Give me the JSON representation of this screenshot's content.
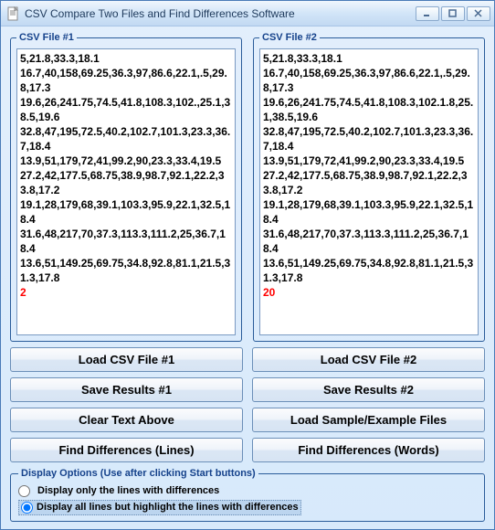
{
  "window": {
    "title": "CSV Compare Two Files and Find Differences Software"
  },
  "files": {
    "left": {
      "legend": "CSV File #1",
      "lines": [
        {
          "text": "5,21.8,33.3,18.1",
          "diff": false
        },
        {
          "text": "16.7,40,158,69.25,36.3,97,86.6,22.1,.5,29.8,17.3",
          "diff": false
        },
        {
          "text": "19.6,26,241.75,74.5,41.8,108.3,102.,25.1,38.5,19.6",
          "diff": false
        },
        {
          "text": "32.8,47,195,72.5,40.2,102.7,101.3,23.3,36.7,18.4",
          "diff": false
        },
        {
          "text": "13.9,51,179,72,41,99.2,90,23.3,33.4,19.5",
          "diff": false
        },
        {
          "text": "27.2,42,177.5,68.75,38.9,98.7,92.1,22.2,33.8,17.2",
          "diff": false
        },
        {
          "text": "19.1,28,179,68,39.1,103.3,95.9,22.1,32.5,18.4",
          "diff": false
        },
        {
          "text": "31.6,48,217,70,37.3,113.3,111.2,25,36.7,18.4",
          "diff": false
        },
        {
          "text": "13.6,51,149.25,69.75,34.8,92.8,81.1,21.5,31.3,17.8",
          "diff": false
        },
        {
          "text": "2",
          "diff": true
        }
      ]
    },
    "right": {
      "legend": "CSV File #2",
      "lines": [
        {
          "text": "5,21.8,33.3,18.1",
          "diff": false
        },
        {
          "text": "16.7,40,158,69.25,36.3,97,86.6,22.1,.5,29.8,17.3",
          "diff": false
        },
        {
          "text": "19.6,26,241.75,74.5,41.8,108.3,102.1.8,25.1,38.5,19.6",
          "diff": false
        },
        {
          "text": "32.8,47,195,72.5,40.2,102.7,101.3,23.3,36.7,18.4",
          "diff": false
        },
        {
          "text": "13.9,51,179,72,41,99.2,90,23.3,33.4,19.5",
          "diff": false
        },
        {
          "text": "27.2,42,177.5,68.75,38.9,98.7,92.1,22.2,33.8,17.2",
          "diff": false
        },
        {
          "text": "19.1,28,179,68,39.1,103.3,95.9,22.1,32.5,18.4",
          "diff": false
        },
        {
          "text": "31.6,48,217,70,37.3,113.3,111.2,25,36.7,18.4",
          "diff": false
        },
        {
          "text": "13.6,51,149.25,69.75,34.8,92.8,81.1,21.5,31.3,17.8",
          "diff": false
        },
        {
          "text": "20",
          "diff": true
        }
      ]
    }
  },
  "buttons": {
    "load1": "Load CSV File #1",
    "load2": "Load CSV File #2",
    "save1": "Save Results #1",
    "save2": "Save Results #2",
    "clear": "Clear Text Above",
    "sample": "Load Sample/Example Files",
    "diffLines": "Find Differences (Lines)",
    "diffWords": "Find Differences (Words)"
  },
  "display": {
    "legend": "Display Options (Use after clicking Start buttons)",
    "opt1": "Display only the lines with differences",
    "opt2": "Display all lines but highlight the lines with differences",
    "selected": "opt2"
  }
}
